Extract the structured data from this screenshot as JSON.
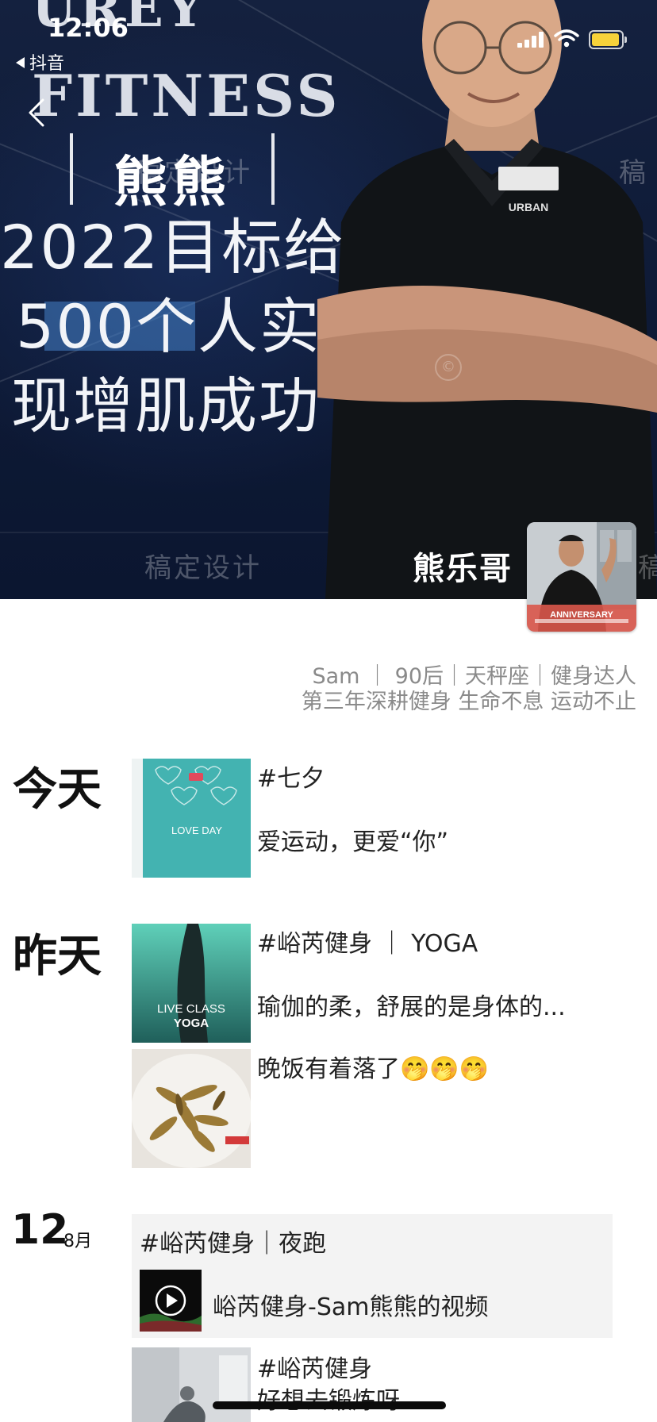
{
  "status_bar": {
    "time": "12:06",
    "back_app": "抖音"
  },
  "cover": {
    "brand_top": "UREY",
    "brand_fitness": "FITNESS",
    "nameplate": "熊熊",
    "headline_lines": [
      "2022目标给",
      "500个人实",
      "现增肌成功"
    ],
    "watermark_center": "稿定设计",
    "watermark_right": "稿",
    "watermark_bottom": "稿定设计",
    "watermark_bottom_right": "稿",
    "shirt_badge": "URBAN",
    "profile_name": "熊乐哥",
    "avatar_caption": "ANNIVERSARY"
  },
  "bio": {
    "line1": "Sam ｜ 90后｜天秤座｜健身达人",
    "line2": "第三年深耕健身 生命不息 运动不止"
  },
  "timeline": {
    "today": {
      "label": "今天",
      "post": {
        "title": "#七夕",
        "text": "爱运动，更爱“你”",
        "thumb_caption": "LOVE DAY"
      }
    },
    "yesterday": {
      "label": "昨天",
      "post1": {
        "title": "#峪芮健身 ｜ YOGA",
        "text": "瑜伽的柔，舒展的是身体的...",
        "thumb_line1": "LIVE CLASS",
        "thumb_line2": "YOGA"
      },
      "post2": {
        "text": "晚饭有着落了🤭🤭🤭"
      }
    },
    "date_entry": {
      "day": "12",
      "month": "8月",
      "card": {
        "title": "#峪芮健身｜夜跑",
        "video_label": "峪芮健身-Sam熊熊的视频"
      },
      "post": {
        "title": "#峪芮健身",
        "text": "好想去锻炼呀"
      }
    }
  },
  "colors": {
    "cover_bg": "#0e1a36",
    "battery": "#f7d23a",
    "card_bg": "#f3f3f3"
  }
}
